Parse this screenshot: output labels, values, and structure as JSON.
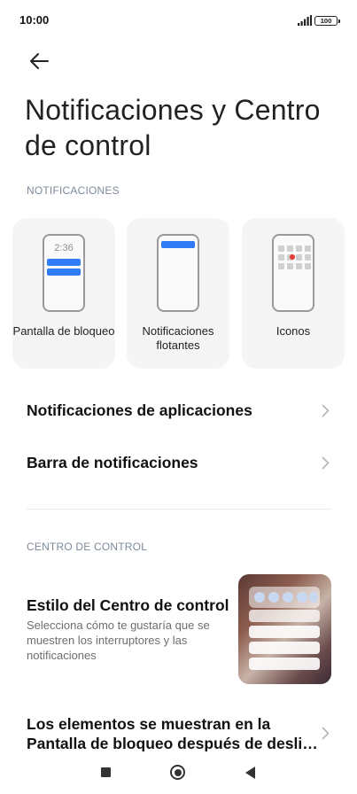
{
  "status_bar": {
    "time": "10:00",
    "battery": "100"
  },
  "page": {
    "title": "Notificaciones y Centro de control"
  },
  "sections": {
    "notifications": "NOTIFICACIONES",
    "control_center": "CENTRO DE CONTROL"
  },
  "cards": [
    {
      "label": "Pantalla de bloqueo",
      "preview_time": "2:36"
    },
    {
      "label": "Notificaciones flotantes"
    },
    {
      "label": "Iconos"
    }
  ],
  "rows": [
    {
      "title": "Notificaciones de aplicaciones"
    },
    {
      "title": "Barra de notificaciones"
    }
  ],
  "control_style": {
    "title": "Estilo del Centro de control",
    "description": "Selecciona cómo te gustaría que se muestren los interruptores y las notificaciones"
  },
  "lockscreen_row": {
    "title": "Los elementos se muestran en la Pantalla de bloqueo después de desli…"
  },
  "colors": {
    "accent": "#2f7cf6",
    "badge_red": "#e53935",
    "section_label": "#7d8a99"
  },
  "icons": [
    "signal-icon",
    "battery-icon",
    "back-arrow-icon",
    "chevron-right-icon",
    "recents-icon",
    "home-icon",
    "nav-back-icon"
  ]
}
